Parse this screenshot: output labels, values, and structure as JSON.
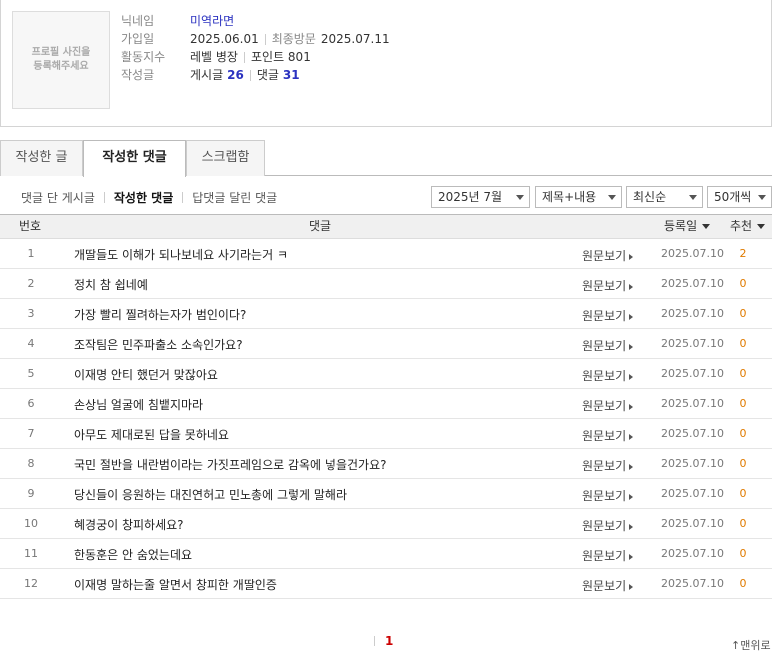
{
  "profile": {
    "photo_placeholder": "프로필 사진을\n등록해주세요",
    "nickname_label": "닉네임",
    "nickname": "미역라면",
    "joined_label": "가입일",
    "joined": "2025.06.01",
    "last_visit_label": "최종방문",
    "last_visit": "2025.07.11",
    "activity_label": "활동지수",
    "level": "레벨 병장",
    "points": "포인트 801",
    "posts_label": "작성글",
    "posts_text": "게시글",
    "posts_count": "26",
    "comments_text": "댓글",
    "comments_count": "31"
  },
  "tabs": [
    "작성한 글",
    "작성한 댓글",
    "스크랩함"
  ],
  "subnav": [
    "댓글 단 게시글",
    "작성한 댓글",
    "답댓글 달린 댓글"
  ],
  "filters": {
    "month": "2025년 7월",
    "search_scope": "제목+내용",
    "sort": "최신순",
    "per_page": "50개씩"
  },
  "table": {
    "headers": {
      "num": "번호",
      "comment": "댓글",
      "date": "등록일",
      "recommend": "추천"
    },
    "orig_label": "원문보기",
    "rows": [
      {
        "num": "1",
        "text": "개딸들도 이해가 되나보네요 사기라는거 ㅋ",
        "date": "2025.07.10",
        "rec": "2"
      },
      {
        "num": "2",
        "text": "정치 참 쉽네예",
        "date": "2025.07.10",
        "rec": "0"
      },
      {
        "num": "3",
        "text": "가장 빨리 찔려하는자가 범인이다?",
        "date": "2025.07.10",
        "rec": "0"
      },
      {
        "num": "4",
        "text": "조작팀은 민주파출소 소속인가요?",
        "date": "2025.07.10",
        "rec": "0"
      },
      {
        "num": "5",
        "text": "이재명 안티 했던거 맞잖아요",
        "date": "2025.07.10",
        "rec": "0"
      },
      {
        "num": "6",
        "text": "손상님 얼굴에 침뱉지마라",
        "date": "2025.07.10",
        "rec": "0"
      },
      {
        "num": "7",
        "text": "아무도 제대로된 답을 못하네요",
        "date": "2025.07.10",
        "rec": "0"
      },
      {
        "num": "8",
        "text": "국민 절반을 내란범이라는 가짓프레임으로 감옥에 넣을건가요?",
        "date": "2025.07.10",
        "rec": "0"
      },
      {
        "num": "9",
        "text": "당신들이 응원하는 대진연허고 민노총에 그렇게 말해라",
        "date": "2025.07.10",
        "rec": "0"
      },
      {
        "num": "10",
        "text": "혜경궁이 창피하세요?",
        "date": "2025.07.10",
        "rec": "0"
      },
      {
        "num": "11",
        "text": "한동훈은 안 숨었는데요",
        "date": "2025.07.10",
        "rec": "0"
      },
      {
        "num": "12",
        "text": "이재명 말하는줄 알면서 창피한 개딸인증",
        "date": "2025.07.10",
        "rec": "0"
      }
    ]
  },
  "paging": {
    "current": "1"
  },
  "to_top": "맨위로"
}
